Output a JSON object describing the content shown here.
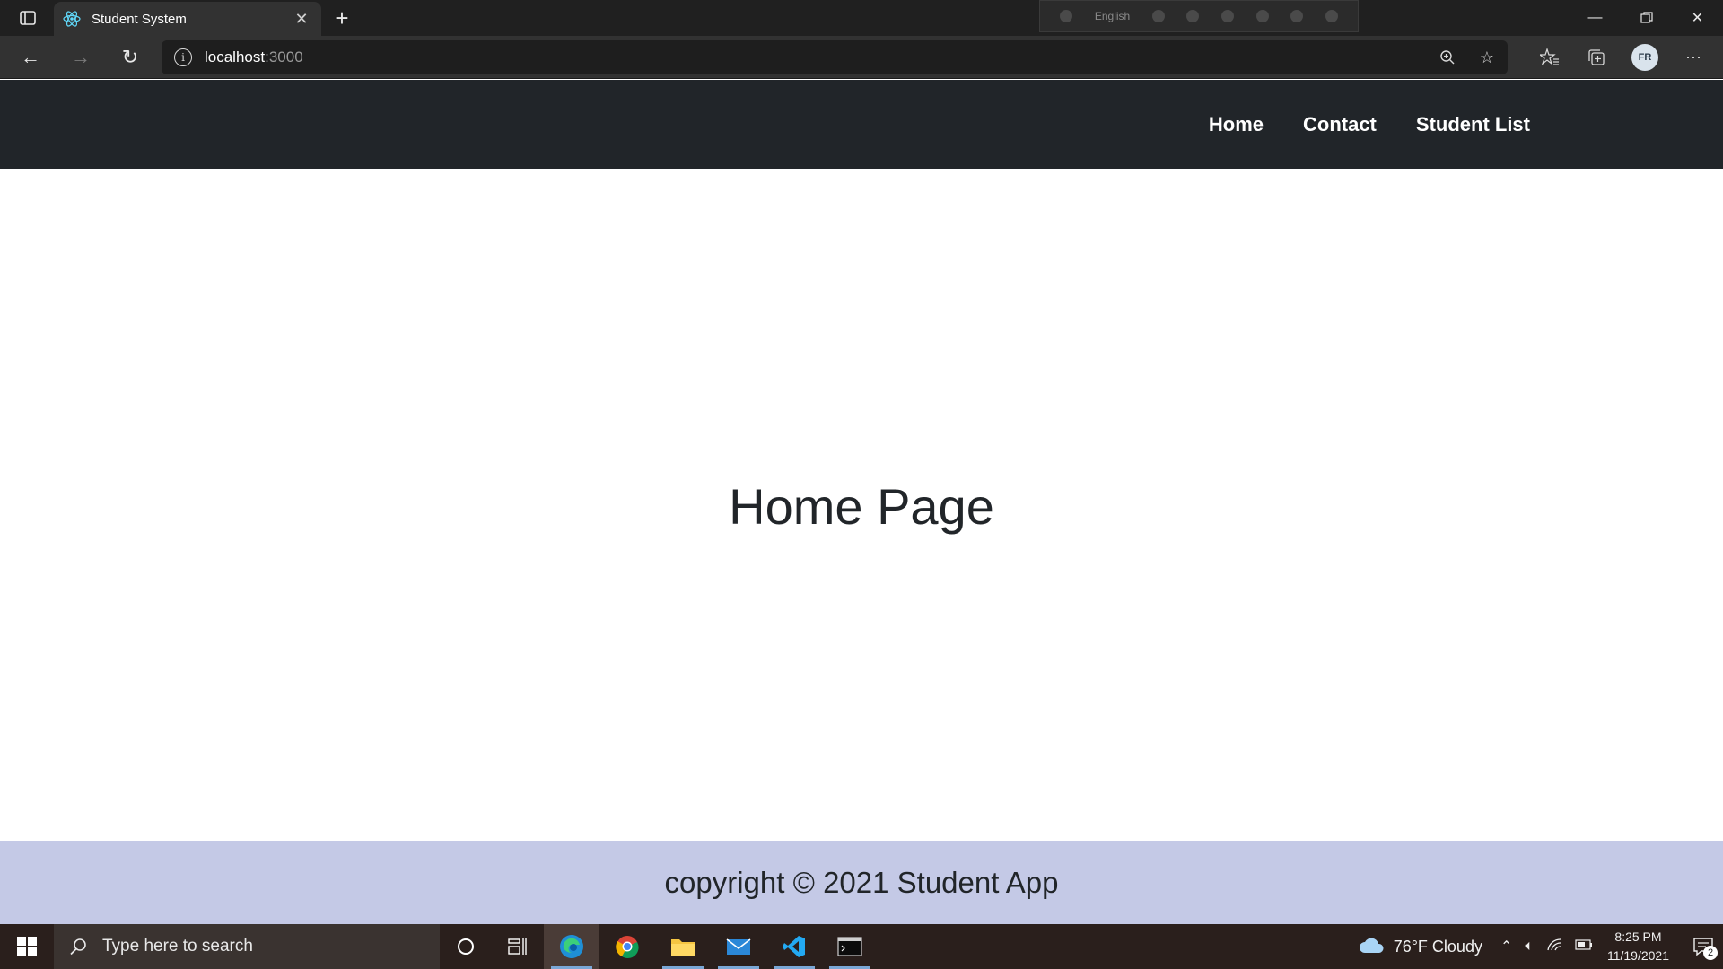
{
  "browser": {
    "tab_title": "Student System",
    "url_host": "localhost",
    "url_port": ":3000",
    "profile_initials": "FR",
    "ime_language": "English"
  },
  "site": {
    "nav": [
      "Home",
      "Contact",
      "Student List"
    ],
    "page_title": "Home Page",
    "footer": "copyright © 2021 Student App"
  },
  "taskbar": {
    "search_placeholder": "Type here to search",
    "weather": "76°F  Cloudy",
    "time": "8:25 PM",
    "date": "11/19/2021",
    "notification_count": "2"
  },
  "colors": {
    "navbar_bg": "#212529",
    "footer_bg": "#c4c9e6",
    "text_dark": "#212529"
  }
}
